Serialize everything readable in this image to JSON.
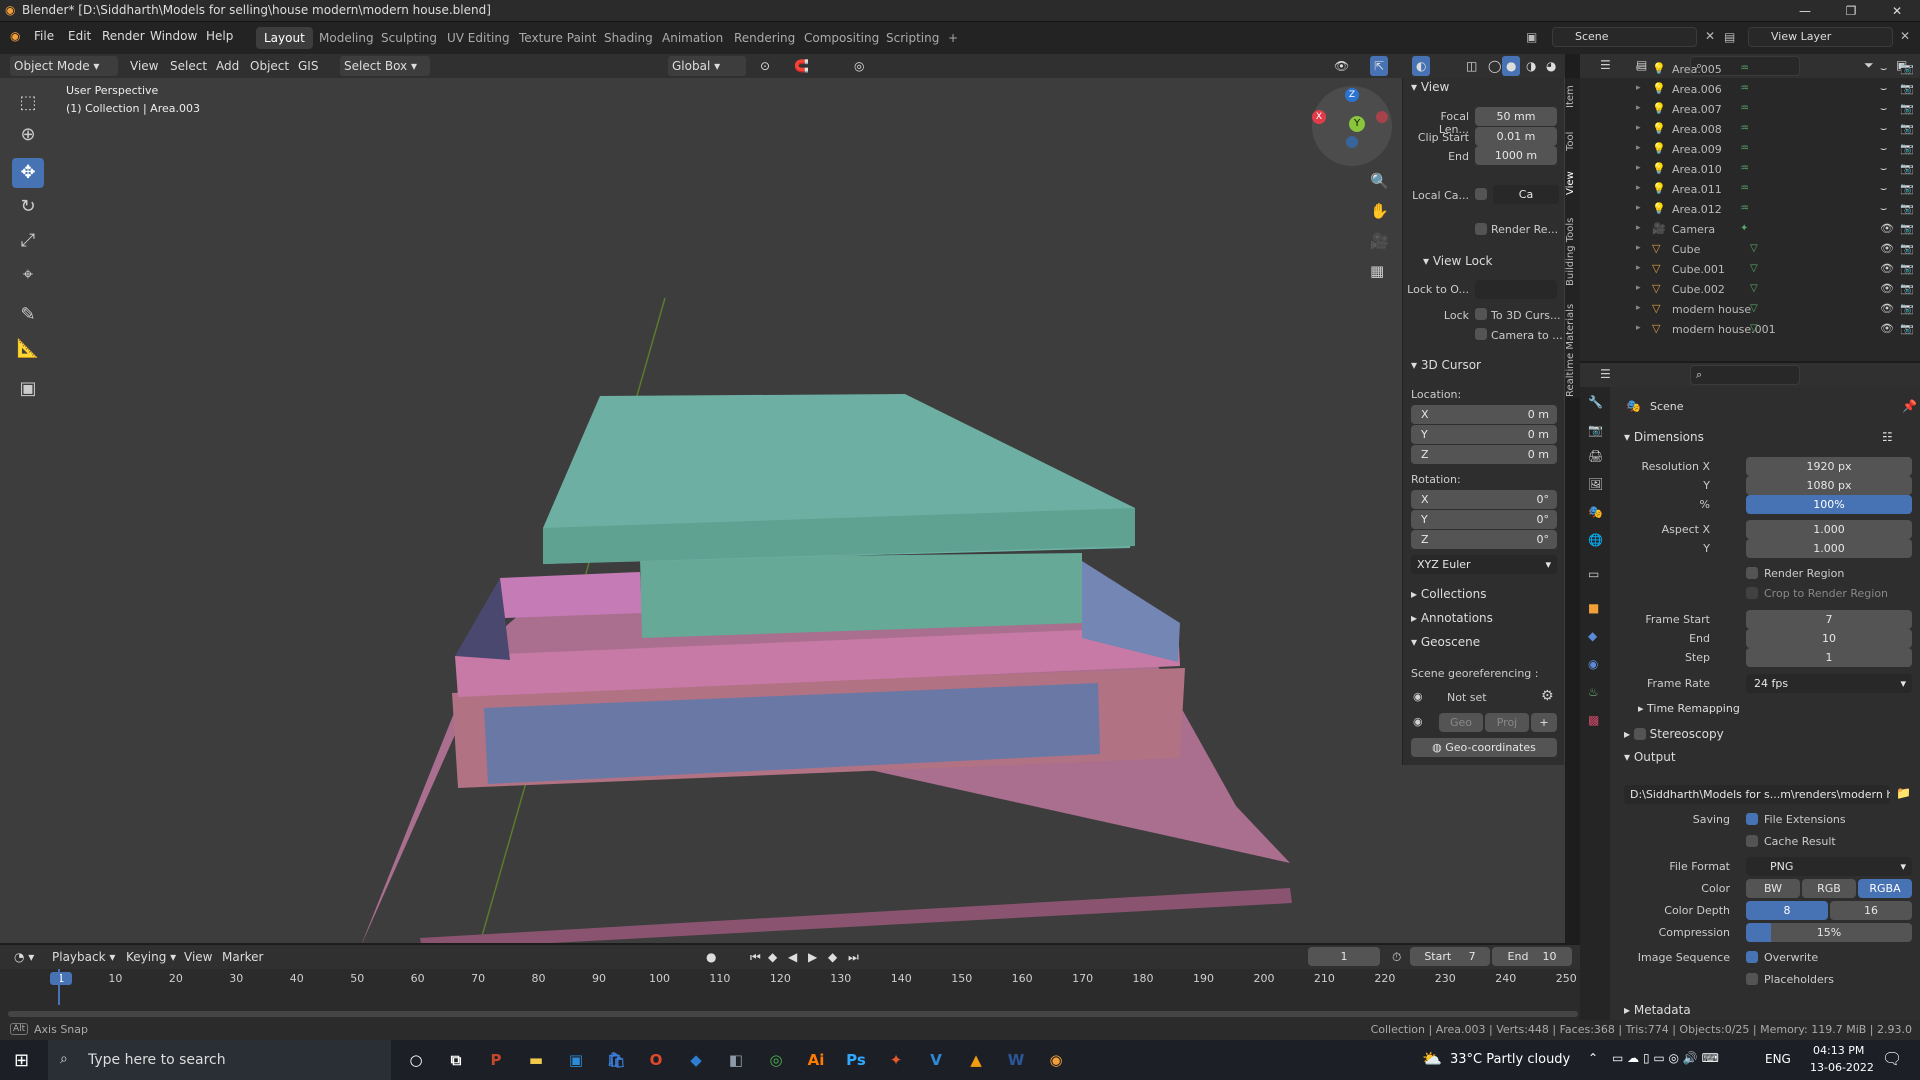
{
  "window": {
    "title": "Blender* [D:\\Siddharth\\Models for selling\\house modern\\modern house.blend]"
  },
  "menubar": {
    "items": [
      "File",
      "Edit",
      "Render",
      "Window",
      "Help"
    ],
    "workspaces": [
      "Layout",
      "Modeling",
      "Sculpting",
      "UV Editing",
      "Texture Paint",
      "Shading",
      "Animation",
      "Rendering",
      "Compositing",
      "Scripting"
    ],
    "active_workspace": "Layout",
    "add_workspace": "+",
    "scene": "Scene",
    "view_layer": "View Layer"
  },
  "viewport_header": {
    "mode": "Object Mode",
    "view": "View",
    "select": "Select",
    "add": "Add",
    "object": "Object",
    "gis": "GIS",
    "select_box": "Select Box",
    "orientation": "Global"
  },
  "viewport": {
    "perspective": "User Perspective",
    "collection_info": "(1) Collection | Area.003",
    "gizmo": {
      "x": "X",
      "y": "Y",
      "z": "Z"
    }
  },
  "npanel": {
    "view_header": "View",
    "focal_length_label": "Focal Len...",
    "focal_length": "50 mm",
    "clip_start_label": "Clip Start",
    "clip_start": "0.01 m",
    "clip_end_label": "End",
    "clip_end": "1000 m",
    "local_camera_label": "Local Ca...",
    "local_camera_value": "Ca",
    "render_region_label": "Render Re...",
    "view_lock_header": "View Lock",
    "lock_to_object_label": "Lock to O...",
    "lock_label": "Lock",
    "to_3d_cursor": "To 3D Curs...",
    "camera_to": "Camera to ...",
    "cursor_header": "3D Cursor",
    "location_label": "Location:",
    "loc_x": "0 m",
    "loc_y": "0 m",
    "loc_z": "0 m",
    "rotation_label": "Rotation:",
    "rot_x": "0°",
    "rot_y": "0°",
    "rot_z": "0°",
    "rotation_mode": "XYZ Euler",
    "collections": "Collections",
    "annotations": "Annotations",
    "geoscene": "Geoscene",
    "scene_geo": "Scene georeferencing :",
    "not_set": "Not set",
    "geo": "Geo",
    "proj": "Proj",
    "geo_coords": "Geo-coordinates",
    "axis_labels": {
      "x": "X",
      "y": "Y",
      "z": "Z"
    }
  },
  "side_tabs": [
    "Item",
    "Tool",
    "View",
    "Building Tools",
    "Realtime Materials"
  ],
  "outliner": {
    "rows": [
      {
        "name": "Area.005",
        "type": "light"
      },
      {
        "name": "Area.006",
        "type": "light"
      },
      {
        "name": "Area.007",
        "type": "light"
      },
      {
        "name": "Area.008",
        "type": "light"
      },
      {
        "name": "Area.009",
        "type": "light"
      },
      {
        "name": "Area.010",
        "type": "light"
      },
      {
        "name": "Area.011",
        "type": "light"
      },
      {
        "name": "Area.012",
        "type": "light"
      },
      {
        "name": "Camera",
        "type": "camera"
      },
      {
        "name": "Cube",
        "type": "mesh"
      },
      {
        "name": "Cube.001",
        "type": "mesh"
      },
      {
        "name": "Cube.002",
        "type": "mesh"
      },
      {
        "name": "modern house",
        "type": "mesh"
      },
      {
        "name": "modern house.001",
        "type": "mesh"
      }
    ]
  },
  "properties": {
    "scene": "Scene",
    "dimensions": "Dimensions",
    "res_x_label": "Resolution X",
    "res_x": "1920 px",
    "res_y_label": "Y",
    "res_y": "1080 px",
    "pct_label": "%",
    "pct": "100%",
    "aspect_x_label": "Aspect X",
    "aspect_x": "1.000",
    "aspect_y_label": "Y",
    "aspect_y": "1.000",
    "render_region": "Render Region",
    "crop": "Crop to Render Region",
    "frame_start_label": "Frame Start",
    "frame_start": "7",
    "frame_end_label": "End",
    "frame_end": "10",
    "frame_step_label": "Step",
    "frame_step": "1",
    "frame_rate_label": "Frame Rate",
    "frame_rate": "24 fps",
    "time_remapping": "Time Remapping",
    "stereoscopy": "Stereoscopy",
    "output": "Output",
    "output_path": "D:\\Siddharth\\Models for s...m\\renders\\modern house",
    "saving_label": "Saving",
    "file_ext": "File Extensions",
    "cache_result": "Cache Result",
    "file_format_label": "File Format",
    "file_format": "PNG",
    "color_label": "Color",
    "color_bw": "BW",
    "color_rgb": "RGB",
    "color_rgba": "RGBA",
    "color_depth_label": "Color Depth",
    "depth_8": "8",
    "depth_16": "16",
    "compression_label": "Compression",
    "compression": "15%",
    "image_seq_label": "Image Sequence",
    "overwrite": "Overwrite",
    "placeholders": "Placeholders",
    "metadata": "Metadata"
  },
  "timeline": {
    "playback": "Playback",
    "keying": "Keying",
    "view": "View",
    "marker": "Marker",
    "current_frame": "1",
    "start_label": "Start",
    "start": "7",
    "end_label": "End",
    "end": "10",
    "ticks": [
      "1",
      "10",
      "20",
      "30",
      "40",
      "50",
      "60",
      "70",
      "80",
      "90",
      "100",
      "110",
      "120",
      "130",
      "140",
      "150",
      "160",
      "170",
      "180",
      "190",
      "200",
      "210",
      "220",
      "230",
      "240",
      "250"
    ]
  },
  "statusbar": {
    "left_key": "Alt",
    "left": "Axis Snap",
    "right": "Collection | Area.003 | Verts:448 | Faces:368 | Tris:774 | Objects:0/25 | Memory: 119.7 MiB | 2.93.0"
  },
  "taskbar": {
    "search_placeholder": "Type here to search",
    "weather": "33°C  Partly cloudy",
    "lang": "ENG",
    "time": "04:13 PM",
    "date": "13-06-2022",
    "apps": [
      "cortana-icon",
      "task-view-icon",
      "powerpoint-icon",
      "file-explorer-icon",
      "photos-icon",
      "store-icon",
      "office-icon",
      "finder-icon",
      "app-icon",
      "chrome-icon",
      "illustrator-icon",
      "photoshop-icon",
      "app2-icon",
      "vectornator-icon",
      "vlc-icon",
      "word-icon",
      "blender-icon"
    ]
  }
}
